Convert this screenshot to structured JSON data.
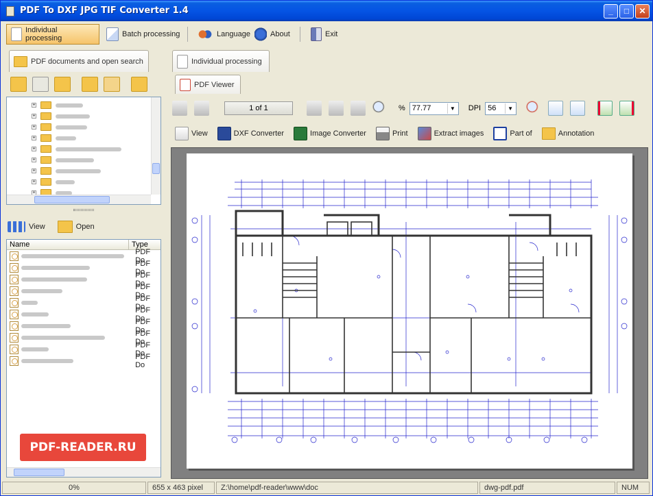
{
  "window": {
    "title": "PDF To DXF JPG TIF Converter 1.4",
    "controls": {
      "minimize": "_",
      "maximize": "□",
      "close": "✕"
    }
  },
  "toolbar": {
    "individual": "Individual processing",
    "batch": "Batch processing",
    "language": "Language",
    "about": "About",
    "exit": "Exit"
  },
  "left": {
    "tab": "PDF documents and open search",
    "view": "View",
    "open": "Open",
    "columns": {
      "name": "Name",
      "type": "Type"
    },
    "file_type": "PDF Do",
    "file_count": 10
  },
  "right": {
    "tab": "Individual processing",
    "subtab": "PDF Viewer",
    "page": "1 of 1",
    "zoom_symbol": "%",
    "zoom": "77.77",
    "dpi_label": "DPI",
    "dpi": "56",
    "actions": {
      "view": "View",
      "dxf": "DXF Converter",
      "image": "Image Converter",
      "print": "Print",
      "extract": "Extract images",
      "part": "Part of",
      "annotation": "Annotation"
    }
  },
  "status": {
    "progress": "0%",
    "size": "655 x 463 pixel",
    "path": "Z:\\home\\pdf-reader\\www\\doc",
    "file": "dwg-pdf.pdf",
    "num": "NUM"
  },
  "watermark": "PDF-READER.RU",
  "colors": {
    "accent": "#0554e4",
    "active": "#f6c46a",
    "drawing": "#2222cc"
  }
}
